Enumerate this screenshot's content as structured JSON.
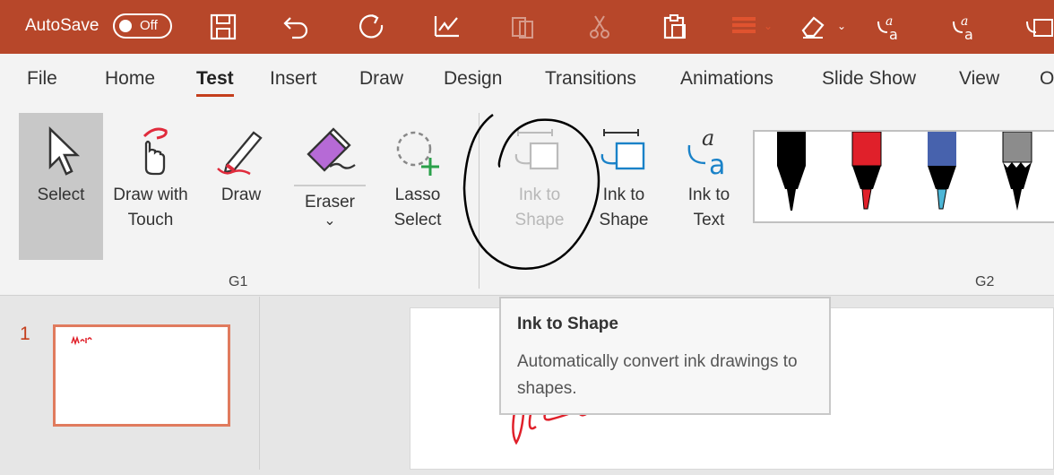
{
  "qat": {
    "autosave_label": "AutoSave",
    "autosave_state": "Off",
    "icons": [
      "save-icon",
      "undo-icon",
      "redo-icon",
      "ink-replay-icon",
      "copy-icon",
      "cut-icon",
      "paste-icon",
      "shapes-icon",
      "eraser-icon",
      "ink-to-text-icon",
      "ink-math-icon",
      "ink-to-shape-icon"
    ],
    "accent": "#b7472a"
  },
  "tabs": [
    {
      "label": "File"
    },
    {
      "label": "Home"
    },
    {
      "label": "Test",
      "active": true
    },
    {
      "label": "Insert"
    },
    {
      "label": "Draw"
    },
    {
      "label": "Design"
    },
    {
      "label": "Transitions"
    },
    {
      "label": "Animations"
    },
    {
      "label": "Slide Show"
    },
    {
      "label": "View"
    },
    {
      "label": "O"
    }
  ],
  "ribbon": {
    "select": {
      "label": "Select"
    },
    "draw_with_touch": {
      "line1": "Draw with",
      "line2": "Touch"
    },
    "draw": {
      "label": "Draw"
    },
    "eraser": {
      "label": "Eraser",
      "chevron": "⌄"
    },
    "lasso": {
      "line1": "Lasso",
      "line2": "Select"
    },
    "ink_to_shape_disabled": {
      "line1": "Ink to",
      "line2": "Shape"
    },
    "ink_to_shape": {
      "line1": "Ink to",
      "line2": "Shape"
    },
    "ink_to_text": {
      "line1": "Ink to",
      "line2": "Text"
    },
    "group1_label": "G1",
    "group2_label": "G2",
    "pens": [
      {
        "color": "#000000"
      },
      {
        "color": "#e0202a"
      },
      {
        "color": "#3a8fd6"
      },
      {
        "color": "#8c8c8c"
      }
    ]
  },
  "slides": {
    "number": "1"
  },
  "tooltip": {
    "title": "Ink to Shape",
    "description": "Automatically convert ink drawings to shapes."
  }
}
